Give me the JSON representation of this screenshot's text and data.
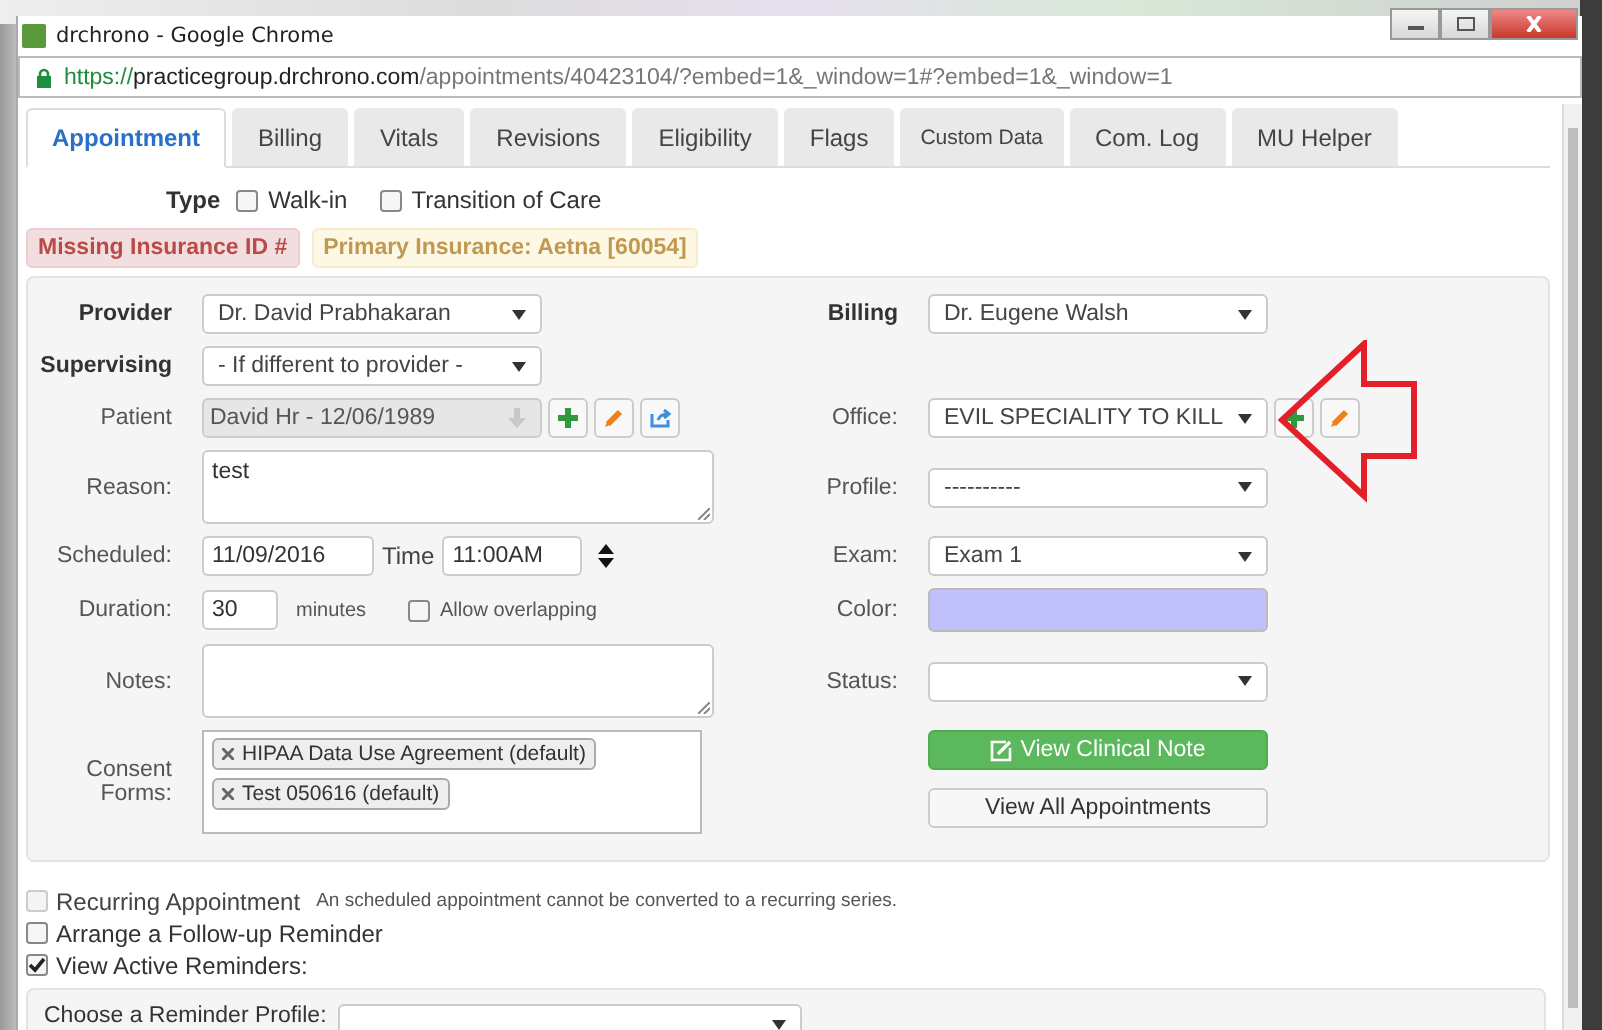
{
  "window": {
    "title": "drchrono - Google Chrome"
  },
  "address": {
    "scheme": "https://",
    "host": "practicegroup.drchrono.com",
    "path": "/appointments/40423104/?embed=1&_window=1#?embed=1&_window=1"
  },
  "tabs": [
    {
      "label": "Appointment",
      "selected": true
    },
    {
      "label": "Billing",
      "selected": false
    },
    {
      "label": "Vitals",
      "selected": false
    },
    {
      "label": "Revisions",
      "selected": false
    },
    {
      "label": "Eligibility",
      "selected": false
    },
    {
      "label": "Flags",
      "selected": false
    },
    {
      "label": "Custom Data",
      "selected": false,
      "small": true
    },
    {
      "label": "Com. Log",
      "selected": false
    },
    {
      "label": "MU Helper",
      "selected": false
    }
  ],
  "type": {
    "label": "Type",
    "options": [
      {
        "label": "Walk-in",
        "checked": false
      },
      {
        "label": "Transition of Care",
        "checked": false
      }
    ]
  },
  "alerts": [
    {
      "text": "Missing Insurance ID #",
      "kind": "danger"
    },
    {
      "text": "Primary Insurance: Aetna [60054]",
      "kind": "warning"
    }
  ],
  "form_rows": [
    {
      "left": {
        "kind": "select",
        "label": "Provider",
        "emphasis": true,
        "value": "Dr. David Prabhakaran"
      },
      "right": {
        "kind": "select",
        "label": "Billing",
        "emphasis": true,
        "value": "Dr. Eugene Walsh"
      }
    },
    {
      "left": {
        "kind": "select",
        "label": "Supervising",
        "emphasis": true,
        "value": "- If different to provider -"
      }
    },
    {
      "left": {
        "kind": "patient",
        "label": "Patient",
        "value": "David Hr - 12/06/1989",
        "disabled": true
      },
      "right": {
        "kind": "office",
        "label": "Office:",
        "value": "EVIL SPECIALITY TO KILL"
      }
    },
    {
      "left": {
        "kind": "textarea",
        "label": "Reason:",
        "value": "test"
      },
      "right": {
        "kind": "select",
        "label": "Profile:",
        "value": "----------"
      }
    },
    {
      "left": {
        "kind": "datetime",
        "label": "Scheduled:",
        "value": "11/09/2016",
        "time_label": "Time",
        "time_value": "11:00AM"
      },
      "right": {
        "kind": "select",
        "label": "Exam:",
        "value": "Exam 1"
      }
    },
    {
      "left": {
        "kind": "duration",
        "label": "Duration:",
        "value": "30",
        "unit": "minutes",
        "option": {
          "label": "Allow overlapping",
          "checked": false
        }
      },
      "right": {
        "kind": "color",
        "label": "Color:",
        "color": "#c0c0fb"
      }
    },
    {
      "left": {
        "kind": "textarea",
        "label": "Notes:"
      },
      "right": {
        "kind": "select",
        "label": "Status:"
      }
    },
    {
      "left": {
        "kind": "tags",
        "label": "Consent Forms:",
        "tags": [
          "HIPAA Data Use Agreement (default)",
          "Test 050616 (default)"
        ]
      },
      "right": {
        "kind": "buttons",
        "buttons": [
          {
            "label": "View Clinical Note",
            "kind": "primary"
          },
          {
            "label": "View All Appointments",
            "kind": "default"
          }
        ]
      }
    }
  ],
  "options": [
    {
      "label": "Recurring Appointment",
      "checked": false,
      "disabled": true,
      "note": "An scheduled appointment cannot be converted to a recurring series."
    },
    {
      "label": "Arrange a Follow-up Reminder",
      "checked": false,
      "disabled": false
    },
    {
      "label": "View Active Reminders:",
      "checked": true,
      "disabled": false
    }
  ],
  "reminder": {
    "label": "Choose a Reminder Profile:"
  }
}
